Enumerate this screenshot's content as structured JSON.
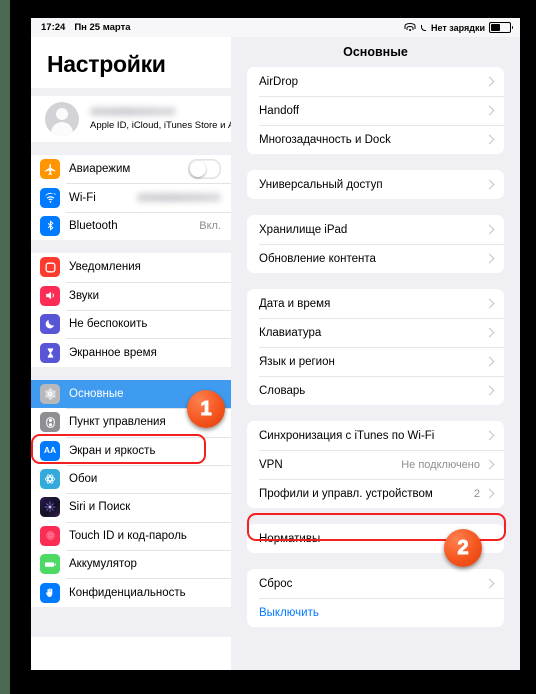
{
  "statusbar": {
    "time": "17:24",
    "date": "Пн 25 марта",
    "wifi_icon": "wifi-icon",
    "location_icon": "location-arrow-icon",
    "battery_text": "Нет зарядки",
    "battery_icon": "battery-icon"
  },
  "sidebar": {
    "title": "Настройки",
    "account": {
      "name_redacted": "",
      "subtitle": "Apple ID, iCloud, iTunes Store и A...",
      "avatar_icon": "avatar-person-icon"
    },
    "groups": [
      {
        "items": [
          {
            "label": "Авиарежим",
            "icon": "airplane-icon",
            "icon_color": "#ff9500",
            "control": "toggle",
            "toggle_on": false
          },
          {
            "label": "Wi-Fi",
            "icon": "wifi-icon",
            "icon_color": "#007aff",
            "value_redacted": true
          },
          {
            "label": "Bluetooth",
            "icon": "bluetooth-icon",
            "icon_color": "#007aff",
            "value": "Вкл."
          }
        ]
      },
      {
        "items": [
          {
            "label": "Уведомления",
            "icon": "notifications-icon",
            "icon_color": "#ff3b30"
          },
          {
            "label": "Звуки",
            "icon": "sounds-speaker-icon",
            "icon_color": "#fc2d55"
          },
          {
            "label": "Не беспокоить",
            "icon": "moon-icon",
            "icon_color": "#5856d6"
          },
          {
            "label": "Экранное время",
            "icon": "hourglass-icon",
            "icon_color": "#5856d6"
          }
        ]
      },
      {
        "items": [
          {
            "label": "Основные",
            "icon": "gear-icon",
            "icon_color": "#8e8e93",
            "selected": true
          },
          {
            "label": "Пункт управления",
            "icon": "control-center-icon",
            "icon_color": "#8e8e93"
          },
          {
            "label": "Экран и яркость",
            "icon": "display-aa-icon",
            "icon_color": "#007aff"
          },
          {
            "label": "Обои",
            "icon": "wallpaper-flower-icon",
            "icon_color": "#34aadc"
          },
          {
            "label": "Siri и Поиск",
            "icon": "siri-icon",
            "icon_color": "#1c1c2e"
          },
          {
            "label": "Touch ID и код-пароль",
            "icon": "fingerprint-icon",
            "icon_color": "#fc2d55"
          },
          {
            "label": "Аккумулятор",
            "icon": "battery-icon",
            "icon_color": "#4cd964"
          },
          {
            "label": "Конфиденциальность",
            "icon": "hand-privacy-icon",
            "icon_color": "#007aff"
          }
        ]
      }
    ]
  },
  "detail": {
    "header_title": "Основные",
    "groups": [
      {
        "items": [
          {
            "label": "AirDrop",
            "chevron": true
          },
          {
            "label": "Handoff",
            "chevron": true
          },
          {
            "label": "Многозадачность и Dock",
            "chevron": true
          }
        ]
      },
      {
        "items": [
          {
            "label": "Универсальный доступ",
            "chevron": true
          }
        ]
      },
      {
        "items": [
          {
            "label": "Хранилище iPad",
            "chevron": true
          },
          {
            "label": "Обновление контента",
            "chevron": true
          }
        ]
      },
      {
        "items": [
          {
            "label": "Дата и время",
            "chevron": true
          },
          {
            "label": "Клавиатура",
            "chevron": true
          },
          {
            "label": "Язык и регион",
            "chevron": true
          },
          {
            "label": "Словарь",
            "chevron": true
          }
        ]
      },
      {
        "items": [
          {
            "label": "Синхронизация с iTunes по Wi-Fi",
            "chevron": true
          },
          {
            "label": "VPN",
            "value": "Не подключено",
            "chevron": true
          },
          {
            "label": "Профили и управл. устройством",
            "value": "2",
            "chevron": true,
            "highlighted": true
          }
        ]
      },
      {
        "items": [
          {
            "label": "Нормативы",
            "chevron": false
          }
        ]
      },
      {
        "items": [
          {
            "label": "Сброс",
            "chevron": true
          },
          {
            "label": "Выключить",
            "chevron": false,
            "link": true
          }
        ]
      }
    ]
  },
  "annotations": {
    "badge_one": "1",
    "badge_two": "2",
    "highlight_color": "#f41f1f",
    "badge_color": "#f4551d"
  }
}
